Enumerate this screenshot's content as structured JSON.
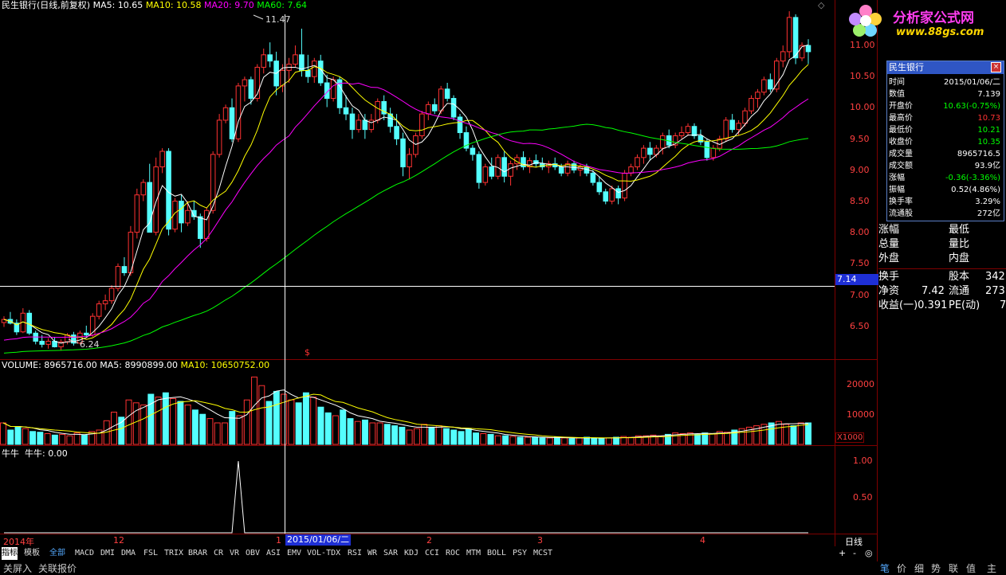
{
  "header": {
    "stock_label": "民生银行(日线,前复权)",
    "ma5": "MA5: 10.65",
    "ma10": "MA10: 10.58",
    "ma20": "MA20: 9.70",
    "ma60": "MA60: 7.64"
  },
  "annotations": {
    "high_label": "11.47",
    "low_label": "6.24",
    "crosshair_price": "7.14",
    "crosshair_date": "2015/01/06/二"
  },
  "price_axis": [
    "11.00",
    "10.50",
    "10.00",
    "9.50",
    "9.00",
    "8.50",
    "8.00",
    "7.50",
    "7.00",
    "6.50"
  ],
  "volume_header": {
    "volume": "VOLUME: 8965716.00",
    "ma5": "MA5: 8990899.00",
    "ma10": "MA10: 10650752.00"
  },
  "volume_axis": [
    "20000",
    "10000"
  ],
  "volume_unit": "X1000",
  "indicator_header": "牛牛  牛牛: 0.00",
  "indicator_axis": [
    "1.00",
    "0.50"
  ],
  "time_axis": [
    "2014年",
    "12",
    "1",
    "2",
    "3",
    "4"
  ],
  "period_label": "日线",
  "indicator_tabs": [
    "指标",
    "模板",
    "全部",
    "MACD",
    "DMI",
    "DMA",
    "FSL",
    "TRIX",
    "BRAR",
    "CR",
    "VR",
    "OBV",
    "ASI",
    "EMV",
    "VOL-TDX",
    "RSI",
    "WR",
    "SAR",
    "KDJ",
    "CCI",
    "ROC",
    "MTM",
    "BOLL",
    "PSY",
    "MCST"
  ],
  "bottom_tabs_left": [
    "关屏入",
    "关联报价"
  ],
  "bottom_tabs_right": [
    "笔",
    "价",
    "细",
    "势",
    "联",
    "值",
    "主"
  ],
  "zoom_controls": [
    "+",
    "-",
    "◎"
  ],
  "logo": {
    "name": "分析家公式网",
    "url": "www.88gs.com"
  },
  "side_panel": {
    "rows": [
      {
        "a": "涨幅",
        "b": "最低"
      },
      {
        "a": "总量",
        "b": "量比"
      },
      {
        "a": "外盘",
        "b": "内盘"
      },
      {
        "a": "换手",
        "b": "股本",
        "c": "342"
      },
      {
        "a": "净资",
        "a2": "7.42",
        "b": "流通",
        "c": "273"
      },
      {
        "a": "收益(一)0.391",
        "b": "PE(动)",
        "c": "7"
      }
    ]
  },
  "popup": {
    "title": "民生银行",
    "rows": [
      {
        "label": "时间",
        "value": "2015/01/06/二",
        "color": "#ffffff"
      },
      {
        "label": "数值",
        "value": "7.139",
        "color": "#ffffff"
      },
      {
        "label": "开盘价",
        "value": "10.63(-0.75%)",
        "color": "#00ff00"
      },
      {
        "label": "最高价",
        "value": "10.73",
        "color": "#ff3333"
      },
      {
        "label": "最低价",
        "value": "10.21",
        "color": "#00ff00"
      },
      {
        "label": "收盘价",
        "value": "10.35",
        "color": "#00ff00"
      },
      {
        "label": "成交量",
        "value": "8965716.5",
        "color": "#ffffff"
      },
      {
        "label": "成交额",
        "value": "93.9亿",
        "color": "#ffffff"
      },
      {
        "label": "涨幅",
        "value": "-0.36(-3.36%)",
        "color": "#00ff00"
      },
      {
        "label": "振幅",
        "value": "0.52(4.86%)",
        "color": "#ffffff"
      },
      {
        "label": "换手率",
        "value": "3.29%",
        "color": "#ffffff"
      },
      {
        "label": "流通股",
        "value": "272亿",
        "color": "#ffffff"
      }
    ]
  },
  "colors": {
    "up": "#ff3232",
    "down": "#54ffff",
    "ma5": "#ffffff",
    "ma10": "#ffff00",
    "ma20": "#ff00ff",
    "ma60": "#00ff00",
    "grid": "#7f0000"
  },
  "chart_data": {
    "type": "candlestick",
    "price_range": [
      6.2,
      11.7
    ],
    "candles": [
      [
        6.75,
        6.85,
        6.68,
        6.8
      ],
      [
        6.8,
        6.92,
        6.72,
        6.74
      ],
      [
        6.74,
        6.8,
        6.55,
        6.6
      ],
      [
        6.6,
        6.98,
        6.58,
        6.9
      ],
      [
        6.9,
        6.95,
        6.55,
        6.58
      ],
      [
        6.58,
        6.62,
        6.4,
        6.45
      ],
      [
        6.45,
        6.55,
        6.35,
        6.4
      ],
      [
        6.4,
        6.5,
        6.33,
        6.45
      ],
      [
        6.45,
        6.52,
        6.35,
        6.36
      ],
      [
        6.36,
        6.48,
        6.3,
        6.44
      ],
      [
        6.44,
        6.58,
        6.4,
        6.55
      ],
      [
        6.55,
        6.6,
        6.38,
        6.42
      ],
      [
        6.42,
        6.62,
        6.4,
        6.58
      ],
      [
        6.58,
        6.7,
        6.52,
        6.55
      ],
      [
        6.55,
        6.9,
        6.52,
        6.85
      ],
      [
        6.85,
        7.1,
        6.8,
        7.05
      ],
      [
        7.05,
        7.2,
        6.95,
        7.1
      ],
      [
        7.1,
        7.35,
        7.05,
        7.3
      ],
      [
        7.3,
        7.7,
        7.25,
        7.65
      ],
      [
        7.65,
        7.8,
        7.5,
        7.55
      ],
      [
        7.55,
        8.3,
        7.5,
        8.2
      ],
      [
        8.2,
        8.9,
        8.1,
        8.8
      ],
      [
        8.8,
        9.05,
        8.7,
        9.0
      ],
      [
        9.0,
        9.3,
        8.9,
        8.2
      ],
      [
        8.2,
        9.4,
        8.15,
        9.25
      ],
      [
        9.25,
        9.55,
        9.15,
        9.5
      ],
      [
        9.5,
        9.55,
        8.15,
        8.25
      ],
      [
        8.25,
        8.75,
        8.2,
        8.7
      ],
      [
        8.7,
        8.8,
        8.2,
        8.35
      ],
      [
        8.35,
        8.7,
        8.3,
        8.55
      ],
      [
        8.55,
        8.7,
        8.4,
        8.45
      ],
      [
        8.45,
        8.5,
        7.95,
        8.1
      ],
      [
        8.1,
        8.6,
        8.05,
        8.55
      ],
      [
        8.55,
        9.5,
        8.5,
        9.45
      ],
      [
        9.45,
        10.1,
        9.4,
        10.0
      ],
      [
        10.0,
        10.25,
        9.95,
        10.2
      ],
      [
        10.2,
        10.35,
        9.65,
        9.7
      ],
      [
        9.7,
        10.6,
        9.65,
        10.55
      ],
      [
        10.55,
        10.7,
        10.3,
        10.65
      ],
      [
        10.65,
        10.7,
        10.25,
        10.35
      ],
      [
        10.35,
        10.9,
        10.3,
        10.85
      ],
      [
        10.85,
        11.15,
        10.75,
        11.05
      ],
      [
        11.05,
        11.25,
        10.85,
        10.95
      ],
      [
        10.95,
        11.1,
        10.4,
        10.55
      ],
      [
        10.55,
        10.9,
        10.45,
        10.8
      ],
      [
        10.8,
        11.0,
        10.6,
        10.9
      ],
      [
        10.9,
        11.2,
        10.85,
        11.05
      ],
      [
        11.05,
        11.47,
        10.7,
        10.8
      ],
      [
        10.8,
        11.05,
        10.6,
        10.7
      ],
      [
        10.7,
        11.0,
        10.6,
        10.95
      ],
      [
        10.95,
        11.05,
        10.55,
        10.6
      ],
      [
        10.6,
        10.73,
        10.21,
        10.35
      ],
      [
        10.35,
        10.7,
        10.3,
        10.65
      ],
      [
        10.65,
        10.7,
        10.1,
        10.2
      ],
      [
        10.2,
        10.4,
        10.0,
        10.1
      ],
      [
        10.1,
        10.2,
        9.7,
        9.85
      ],
      [
        9.85,
        10.1,
        9.8,
        10.0
      ],
      [
        10.0,
        10.1,
        9.7,
        9.85
      ],
      [
        9.85,
        10.1,
        9.8,
        10.0
      ],
      [
        10.0,
        10.35,
        9.95,
        10.3
      ],
      [
        10.3,
        10.4,
        10.0,
        10.1
      ],
      [
        10.1,
        10.2,
        9.8,
        9.9
      ],
      [
        9.9,
        10.1,
        9.6,
        9.7
      ],
      [
        9.7,
        9.8,
        9.1,
        9.25
      ],
      [
        9.25,
        9.55,
        9.05,
        9.45
      ],
      [
        9.45,
        9.8,
        9.4,
        9.75
      ],
      [
        9.75,
        10.15,
        9.7,
        10.1
      ],
      [
        10.1,
        10.3,
        10.0,
        10.25
      ],
      [
        10.25,
        10.35,
        10.1,
        10.15
      ],
      [
        10.15,
        10.55,
        10.1,
        10.5
      ],
      [
        10.5,
        10.6,
        10.3,
        10.35
      ],
      [
        10.35,
        10.4,
        10.0,
        10.05
      ],
      [
        10.05,
        10.1,
        9.7,
        9.8
      ],
      [
        9.8,
        9.9,
        9.5,
        9.55
      ],
      [
        9.55,
        9.6,
        9.35,
        9.45
      ],
      [
        9.45,
        9.5,
        8.9,
        9.0
      ],
      [
        9.0,
        9.3,
        8.95,
        9.25
      ],
      [
        9.25,
        9.4,
        9.05,
        9.1
      ],
      [
        9.1,
        9.45,
        9.05,
        9.4
      ],
      [
        9.4,
        9.5,
        9.0,
        9.1
      ],
      [
        9.1,
        9.35,
        8.95,
        9.3
      ],
      [
        9.3,
        9.45,
        9.2,
        9.4
      ],
      [
        9.4,
        9.5,
        9.2,
        9.25
      ],
      [
        9.25,
        9.4,
        9.15,
        9.35
      ],
      [
        9.35,
        9.45,
        9.25,
        9.3
      ],
      [
        9.3,
        9.4,
        9.2,
        9.25
      ],
      [
        9.25,
        9.35,
        9.15,
        9.3
      ],
      [
        9.3,
        9.4,
        9.2,
        9.25
      ],
      [
        9.25,
        9.3,
        9.1,
        9.15
      ],
      [
        9.15,
        9.35,
        9.1,
        9.3
      ],
      [
        9.3,
        9.35,
        9.15,
        9.2
      ],
      [
        9.2,
        9.3,
        9.1,
        9.25
      ],
      [
        9.25,
        9.3,
        9.1,
        9.15
      ],
      [
        9.15,
        9.2,
        8.95,
        9.0
      ],
      [
        9.0,
        9.1,
        8.8,
        8.85
      ],
      [
        8.85,
        8.9,
        8.65,
        8.7
      ],
      [
        8.7,
        8.95,
        8.65,
        8.9
      ],
      [
        8.9,
        8.95,
        8.65,
        8.75
      ],
      [
        8.75,
        9.2,
        8.7,
        9.15
      ],
      [
        9.15,
        9.3,
        9.1,
        9.25
      ],
      [
        9.25,
        9.45,
        9.2,
        9.4
      ],
      [
        9.4,
        9.6,
        9.3,
        9.55
      ],
      [
        9.55,
        9.65,
        9.35,
        9.45
      ],
      [
        9.45,
        9.6,
        9.4,
        9.55
      ],
      [
        9.55,
        9.8,
        9.45,
        9.75
      ],
      [
        9.75,
        9.85,
        9.55,
        9.6
      ],
      [
        9.6,
        9.8,
        9.55,
        9.75
      ],
      [
        9.75,
        9.9,
        9.7,
        9.8
      ],
      [
        9.8,
        9.95,
        9.75,
        9.9
      ],
      [
        9.9,
        9.95,
        9.7,
        9.75
      ],
      [
        9.75,
        9.85,
        9.6,
        9.65
      ],
      [
        9.65,
        9.7,
        9.35,
        9.4
      ],
      [
        9.4,
        9.6,
        9.35,
        9.55
      ],
      [
        9.55,
        9.75,
        9.5,
        9.7
      ],
      [
        9.7,
        10.05,
        9.65,
        10.0
      ],
      [
        10.0,
        10.1,
        9.8,
        9.85
      ],
      [
        9.85,
        10.0,
        9.75,
        9.95
      ],
      [
        9.95,
        10.2,
        9.9,
        10.15
      ],
      [
        10.15,
        10.4,
        10.1,
        10.35
      ],
      [
        10.35,
        10.5,
        10.2,
        10.45
      ],
      [
        10.45,
        10.7,
        10.4,
        10.65
      ],
      [
        10.65,
        10.75,
        10.45,
        10.5
      ],
      [
        10.5,
        11.0,
        10.45,
        10.95
      ],
      [
        10.95,
        11.2,
        10.85,
        11.1
      ],
      [
        11.1,
        11.75,
        11.0,
        11.65
      ],
      [
        11.65,
        11.7,
        10.9,
        11.0
      ],
      [
        11.0,
        11.25,
        10.95,
        11.2
      ],
      [
        11.2,
        11.3,
        10.9,
        11.1
      ]
    ],
    "volume_ratio": [
      0.3,
      0.2,
      0.25,
      0.22,
      0.18,
      0.17,
      0.15,
      0.13,
      0.14,
      0.12,
      0.16,
      0.13,
      0.18,
      0.2,
      0.33,
      0.45,
      0.38,
      0.62,
      0.58,
      0.55,
      0.7,
      0.66,
      0.72,
      0.64,
      0.6,
      0.55,
      0.48,
      0.42,
      0.36,
      0.3,
      0.3,
      0.46,
      0.4,
      0.62,
      0.94,
      0.82,
      0.6,
      0.74,
      0.7,
      0.62,
      0.58,
      0.72,
      0.66,
      0.52,
      0.44,
      0.4,
      0.48,
      0.36,
      0.32,
      0.34,
      0.3,
      0.3,
      0.28,
      0.26,
      0.24,
      0.2,
      0.22,
      0.28,
      0.24,
      0.26,
      0.22,
      0.2,
      0.18,
      0.22,
      0.16,
      0.15,
      0.14,
      0.12,
      0.12,
      0.11,
      0.1,
      0.1,
      0.1,
      0.09,
      0.09,
      0.1,
      0.09,
      0.08,
      0.09,
      0.1,
      0.09,
      0.08,
      0.09,
      0.1,
      0.11,
      0.1,
      0.12,
      0.12,
      0.13,
      0.12,
      0.14,
      0.16,
      0.15,
      0.16,
      0.14,
      0.16,
      0.15,
      0.18,
      0.17,
      0.2,
      0.22,
      0.24,
      0.26,
      0.28,
      0.3,
      0.32,
      0.28,
      0.26,
      0.3,
      0.3
    ],
    "indicator_spike_index": 37
  }
}
